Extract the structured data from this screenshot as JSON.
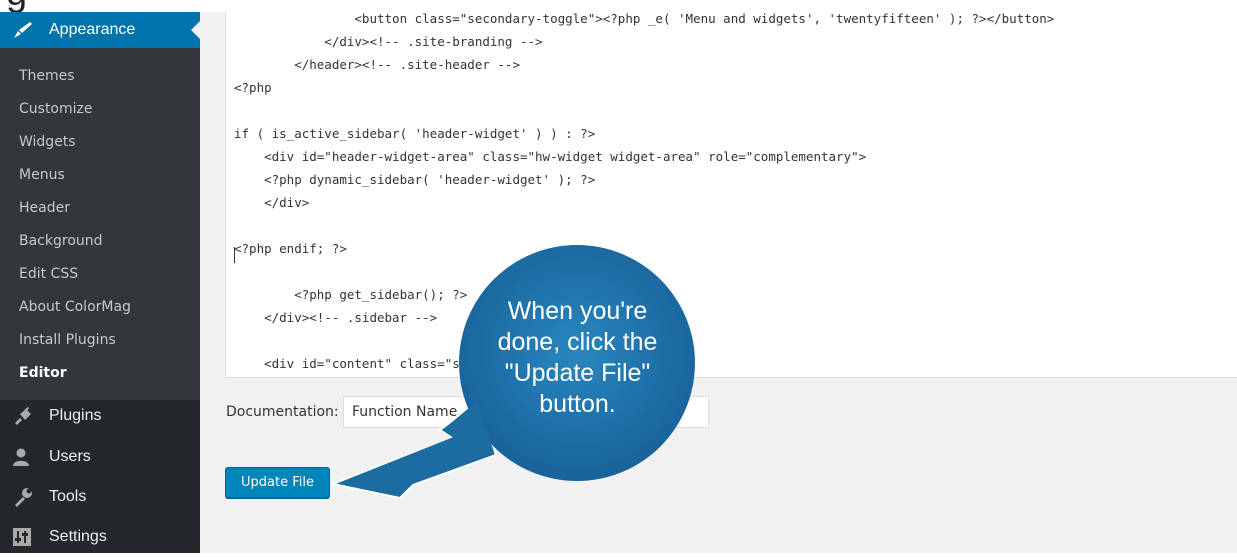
{
  "sidebar": {
    "appearance_label": "Appearance",
    "submenu": [
      {
        "label": "Themes"
      },
      {
        "label": "Customize"
      },
      {
        "label": "Widgets"
      },
      {
        "label": "Menus"
      },
      {
        "label": "Header"
      },
      {
        "label": "Background"
      },
      {
        "label": "Edit CSS"
      },
      {
        "label": "About ColorMag"
      },
      {
        "label": "Install Plugins"
      },
      {
        "label": "Editor",
        "current": true
      }
    ],
    "plugins_label": "Plugins",
    "users_label": "Users",
    "tools_label": "Tools",
    "settings_label": "Settings"
  },
  "editor": {
    "lines": [
      "                <button class=\"secondary-toggle\"><?php _e( 'Menu and widgets', 'twentyfifteen' ); ?></button>",
      "            </div><!-- .site-branding -->",
      "        </header><!-- .site-header -->",
      "<?php",
      "",
      "if ( is_active_sidebar( 'header-widget' ) ) : ?>",
      "    <div id=\"header-widget-area\" class=\"hw-widget widget-area\" role=\"complementary\">",
      "    <?php dynamic_sidebar( 'header-widget' ); ?>",
      "    </div>",
      "",
      "<?php endif; ?>",
      "",
      "        <?php get_sidebar(); ?>",
      "    </div><!-- .sidebar -->",
      "",
      "    <div id=\"content\" class=\"site-content\">"
    ]
  },
  "documentation": {
    "label": "Documentation:",
    "select_value": "Function Name..."
  },
  "update_button": "Update File",
  "callout": {
    "lines": [
      "When you're",
      "done, click the",
      "\"Update File\"",
      "button."
    ]
  },
  "colors": {
    "sidebar_bg": "#23282d",
    "submenu_bg": "#32373c",
    "accent": "#0073aa",
    "button": "#0085ba",
    "callout": "#1e6fa3"
  }
}
